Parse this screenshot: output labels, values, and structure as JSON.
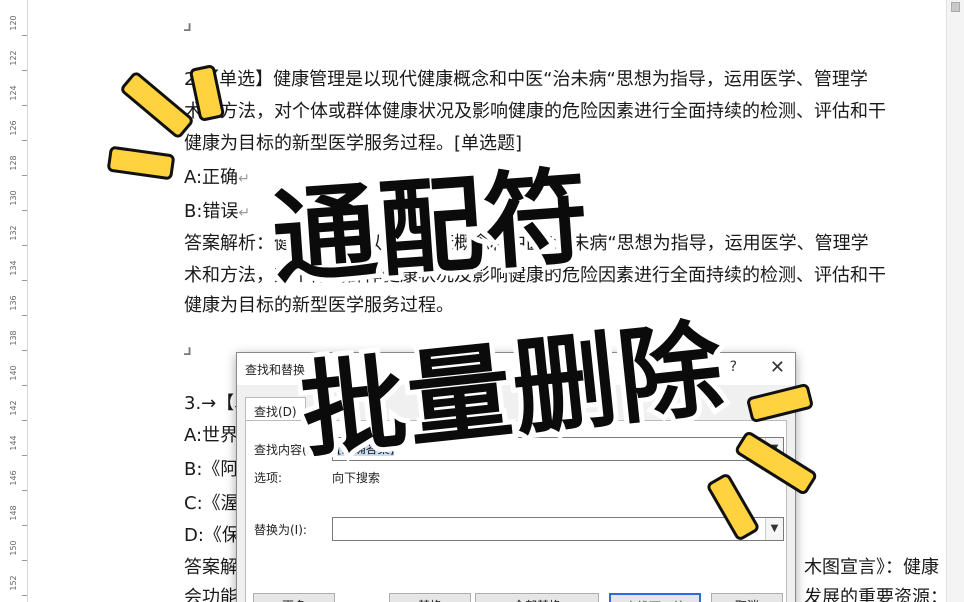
{
  "ruler": {
    "ticks": [
      "120",
      "122",
      "124",
      "126",
      "128",
      "130",
      "132",
      "134",
      "136",
      "138",
      "140",
      "142",
      "144",
      "146",
      "148",
      "150",
      "152"
    ]
  },
  "document": {
    "q2_line1": "2.【单选】健康管理是以现代健康概念和中医“治未病“思想为指导，运用医学、管理学",
    "q2_line2": "术和方法，对个体或群体健康状况及影响健康的危险因素进行全面持续的检测、评估和干",
    "q2_line3": "健康为目标的新型医学服务过程。[单选题]",
    "opt_a": "A:正确",
    "opt_b": "B:错误",
    "ans_line1": "答案解析：健康管理是以现代健康概念和中医“治未病“思想为指导，运用医学、管理学",
    "ans_line2": "术和方法，对个体或群体健康状况及影响健康的危险因素进行全面持续的检测、评估和干",
    "ans_line3": "健康为目标的新型医学服务过程。",
    "q3_line1": "3.→【单选】……理提出的·[单选题",
    "q3_opt_a": "A:世界",
    "q3_opt_b": "B:《阿",
    "q3_opt_c": "C:《渥",
    "q3_opt_d": "D:《保",
    "q3_ans1": "答案解",
    "q3_ans1_tail": "木图宣言》：健康",
    "q3_ans2": "会功能",
    "q3_ans2_tail": "发展的重要资源：",
    "return_mark": "↵"
  },
  "dialog": {
    "title": "查找和替换",
    "help": "?",
    "close": "✕",
    "tab_find": "查找(D)",
    "find_label": "查找内容(N):",
    "find_value": "[正确答案]",
    "options_label": "选项:",
    "options_value": "向下搜索",
    "replace_label": "替换为(I):",
    "replace_value": "",
    "buttons": [
      "更多",
      "替换",
      "全部替换",
      "查找下一处",
      "取消"
    ]
  },
  "overlay": {
    "headline_1": "通配符",
    "headline_2": "批量删除"
  },
  "colors": {
    "ray_fill": "#ffd23f",
    "ray_stroke": "#111111",
    "selection": "#c8dcf5",
    "dialog_bg": "#f0f0f0"
  }
}
